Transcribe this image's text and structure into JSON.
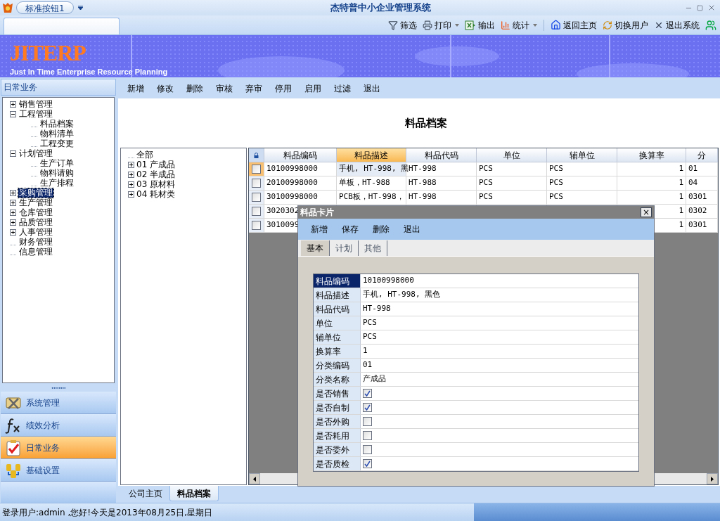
{
  "window": {
    "title": "杰特普中小企业管理系统",
    "quick_button": "标准按钮1"
  },
  "toolbar": [
    {
      "kind": "filter",
      "label": "筛选",
      "dropdown": false
    },
    {
      "kind": "print",
      "label": "打印",
      "dropdown": true
    },
    {
      "kind": "export",
      "label": "输出",
      "dropdown": false
    },
    {
      "kind": "stats",
      "label": "统计",
      "dropdown": true
    },
    {
      "kind": "home",
      "label": "返回主页",
      "dropdown": false
    },
    {
      "kind": "switch",
      "label": "切换用户",
      "dropdown": false
    },
    {
      "kind": "exit",
      "label": "退出系统",
      "dropdown": false
    },
    {
      "kind": "users",
      "dropdown": false
    }
  ],
  "banner": {
    "logo": "JITERP",
    "subtitle": "Just In Time Enterprise Resource Planning"
  },
  "sidebar": {
    "header": "日常业务",
    "tree": [
      {
        "label": "销售管理",
        "expanded": false,
        "selected": false
      },
      {
        "label": "工程管理",
        "expanded": true,
        "selected": false,
        "children": [
          {
            "label": "料品档案",
            "selected": false
          },
          {
            "label": "物料清单",
            "selected": false
          },
          {
            "label": "工程变更",
            "selected": false
          }
        ]
      },
      {
        "label": "计划管理",
        "expanded": true,
        "selected": false,
        "children": [
          {
            "label": "生产订单",
            "selected": false
          },
          {
            "label": "物料请购",
            "selected": false
          },
          {
            "label": "生产排程",
            "selected": false
          }
        ]
      },
      {
        "label": "采购管理",
        "expanded": false,
        "selected": true
      },
      {
        "label": "生产管理",
        "expanded": false,
        "selected": false
      },
      {
        "label": "仓库管理",
        "expanded": false,
        "selected": false
      },
      {
        "label": "品质管理",
        "expanded": false,
        "selected": false
      },
      {
        "label": "人事管理",
        "expanded": false,
        "selected": false
      },
      {
        "label": "财务管理",
        "selected": false
      },
      {
        "label": "信息管理",
        "selected": false
      }
    ],
    "splitter": "••••••••",
    "nav": [
      {
        "kind": "system",
        "label": "系统管理",
        "selected": false
      },
      {
        "kind": "analysis",
        "label": "绩效分析",
        "selected": false
      },
      {
        "kind": "daily",
        "label": "日常业务",
        "selected": true
      },
      {
        "kind": "base",
        "label": "基础设置",
        "selected": false
      }
    ]
  },
  "actions": [
    "新增",
    "修改",
    "删除",
    "审核",
    "弃审",
    "停用",
    "启用",
    "过滤",
    "退出"
  ],
  "page_title": "料品档案",
  "categories": [
    {
      "label": "全部"
    },
    {
      "label": "01  产成品",
      "expanded": false
    },
    {
      "label": "02  半成品",
      "expanded": false
    },
    {
      "label": "03  原材料",
      "expanded": false
    },
    {
      "label": "04  耗材类",
      "expanded": false
    }
  ],
  "table": {
    "columns": [
      {
        "label": "料品编码",
        "selected": false
      },
      {
        "label": "料品描述",
        "selected": true
      },
      {
        "label": "料品代码",
        "selected": false
      },
      {
        "label": "单位",
        "selected": false
      },
      {
        "label": "辅单位",
        "selected": false
      },
      {
        "label": "换算率",
        "selected": false
      },
      {
        "label": "分",
        "selected": false
      }
    ],
    "rows": [
      {
        "selected": true,
        "checked": false,
        "cells": [
          "10100998000",
          "手机, HT-998, 黑",
          "HT-998",
          "PCS",
          "PCS",
          "1",
          "01"
        ]
      },
      {
        "selected": false,
        "checked": false,
        "cells": [
          "20100998000",
          "单板，HT-988",
          "HT-988",
          "PCS",
          "PCS",
          "1",
          "04"
        ]
      },
      {
        "selected": false,
        "checked": false,
        "cells": [
          "30100998000",
          "PCB板，HT-998，",
          "HT-998",
          "PCS",
          "PCS",
          "1",
          "0301"
        ]
      },
      {
        "selected": false,
        "checked": false,
        "cells": [
          "3020302",
          null,
          null,
          null,
          null,
          "1",
          "0302"
        ]
      },
      {
        "selected": false,
        "checked": false,
        "cells": [
          "3010099",
          null,
          null,
          null,
          null,
          "1",
          "0301"
        ]
      }
    ]
  },
  "dialog": {
    "title": "料品卡片",
    "close": "×",
    "actions": [
      "新增",
      "保存",
      "删除",
      "退出"
    ],
    "tabs": [
      {
        "label": "基本",
        "selected": true
      },
      {
        "label": "计划",
        "selected": false
      },
      {
        "label": "其他",
        "selected": false
      }
    ],
    "fields": [
      {
        "kind": "text",
        "label": "料品编码",
        "value": "10100998000",
        "selected": true
      },
      {
        "kind": "text",
        "label": "料品描述",
        "value": "手机, HT-998, 黑色",
        "selected": false
      },
      {
        "kind": "text",
        "label": "料品代码",
        "value": "HT-998",
        "selected": false
      },
      {
        "kind": "text",
        "label": "单位",
        "value": "PCS",
        "selected": false
      },
      {
        "kind": "text",
        "label": "辅单位",
        "value": "PCS",
        "selected": false
      },
      {
        "kind": "text",
        "label": "换算率",
        "value": "1",
        "selected": false
      },
      {
        "kind": "text",
        "label": "分类编码",
        "value": "01",
        "selected": false
      },
      {
        "kind": "text",
        "label": "分类名称",
        "value": "产成品",
        "selected": false
      },
      {
        "kind": "check",
        "label": "是否销售",
        "checked": true,
        "selected": false
      },
      {
        "kind": "check",
        "label": "是否自制",
        "checked": true,
        "selected": false
      },
      {
        "kind": "check",
        "label": "是否外购",
        "checked": false,
        "selected": false
      },
      {
        "kind": "check",
        "label": "是否耗用",
        "checked": false,
        "selected": false
      },
      {
        "kind": "check",
        "label": "是否委外",
        "checked": false,
        "selected": false
      },
      {
        "kind": "check",
        "label": "是否质检",
        "checked": true,
        "selected": false
      }
    ]
  },
  "page_tabs": [
    {
      "label": "公司主页",
      "selected": false
    },
    {
      "label": "料品档案",
      "selected": true
    }
  ],
  "status_bar": "登录用户:admin ,您好!今天是2013年08月25日,星期日"
}
